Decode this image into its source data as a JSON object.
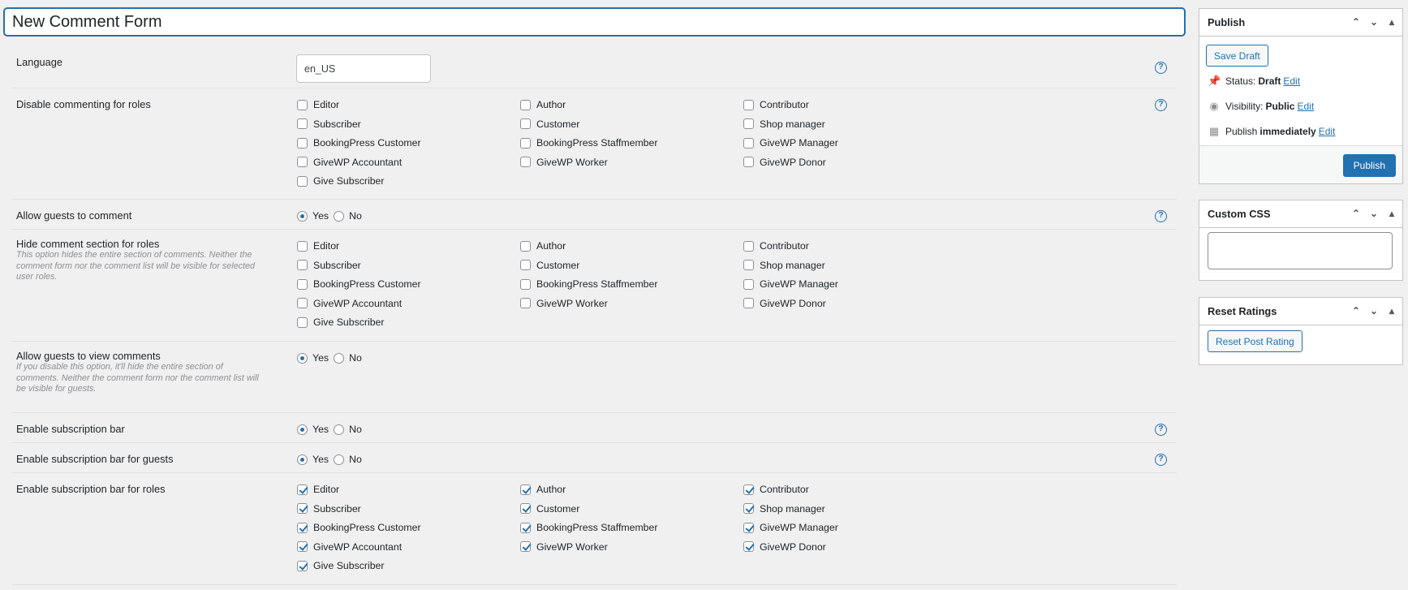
{
  "title": "New Comment Form",
  "roles": [
    "Editor",
    "Author",
    "Contributor",
    "Subscriber",
    "Customer",
    "Shop manager",
    "BookingPress Customer",
    "BookingPress Staffmember",
    "GiveWP Manager",
    "GiveWP Accountant",
    "GiveWP Worker",
    "GiveWP Donor",
    "Give Subscriber"
  ],
  "rows": {
    "language": {
      "label": "Language",
      "value": "en_US"
    },
    "disable_commenting": {
      "label": "Disable commenting for roles"
    },
    "allow_guests": {
      "label": "Allow guests to comment",
      "yes": "Yes",
      "no": "No",
      "selected": "Yes"
    },
    "hide_section": {
      "label": "Hide comment section for roles",
      "desc": "This option hides the entire section of comments. Neither the comment form nor the comment list will be visible for selected user roles."
    },
    "guests_view": {
      "label": "Allow guests to view comments",
      "desc": "If you disable this option, it'll hide the entire section of comments. Neither the comment form nor the comment list will be visible for guests.",
      "yes": "Yes",
      "no": "No",
      "selected": "Yes"
    },
    "sub_bar": {
      "label": "Enable subscription bar",
      "yes": "Yes",
      "no": "No",
      "selected": "Yes"
    },
    "sub_bar_guests": {
      "label": "Enable subscription bar for guests",
      "yes": "Yes",
      "no": "No",
      "selected": "Yes"
    },
    "sub_bar_roles": {
      "label": "Enable subscription bar for roles"
    }
  },
  "help_icon": "?",
  "publish": {
    "title": "Publish",
    "save_draft": "Save Draft",
    "status_label": "Status:",
    "status_value": "Draft",
    "visibility_label": "Visibility:",
    "visibility_value": "Public",
    "publish_label": "Publish",
    "publish_value": "immediately",
    "edit": "Edit",
    "publish_button": "Publish"
  },
  "custom_css": {
    "title": "Custom CSS",
    "value": ""
  },
  "reset_ratings": {
    "title": "Reset Ratings",
    "button": "Reset Post Rating"
  }
}
